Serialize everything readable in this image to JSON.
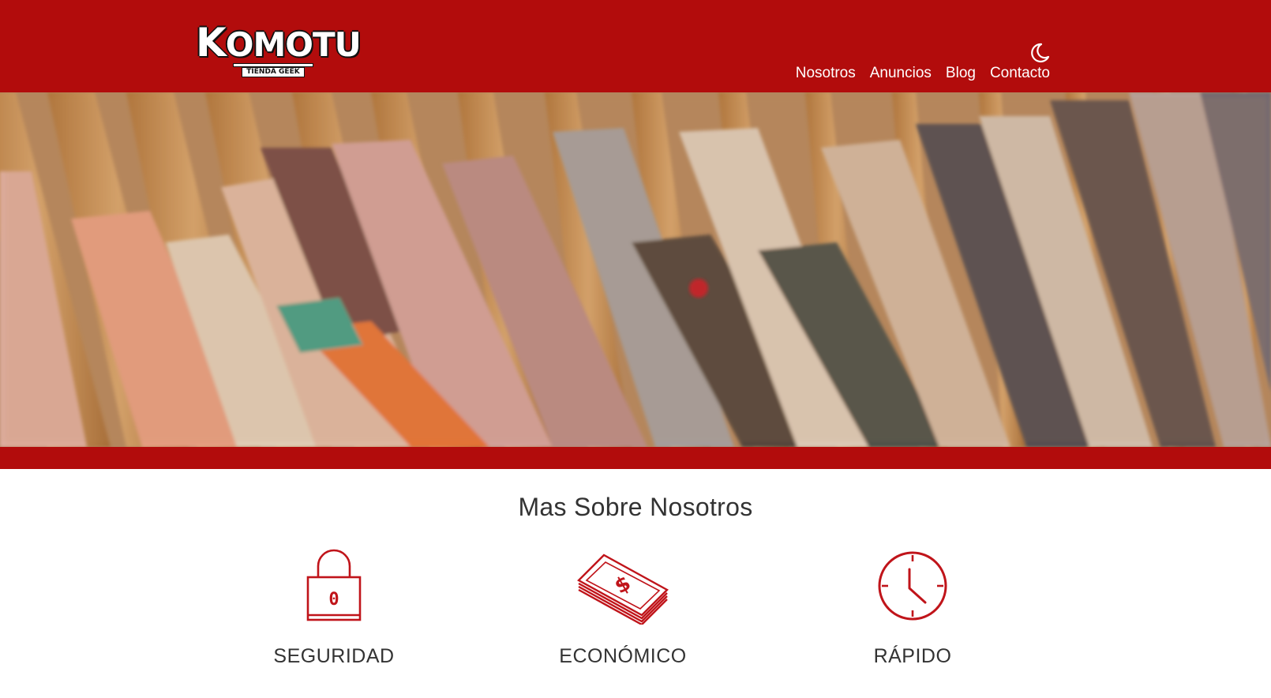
{
  "brand": {
    "name": "KOMOTU",
    "tagline": "TIENDA GEEK",
    "color": "#b20c0c"
  },
  "header": {
    "theme_icon": "moon-icon"
  },
  "nav": {
    "items": [
      "Nosotros",
      "Anuncios",
      "Blog",
      "Contacto"
    ]
  },
  "hero": {
    "image": "clothes-on-hangers-photo"
  },
  "about": {
    "title": "Mas Sobre Nosotros",
    "features": [
      {
        "label": "SEGURIDAD",
        "icon": "padlock-icon"
      },
      {
        "label": "ECONÓMICO",
        "icon": "money-stack-icon"
      },
      {
        "label": "RÁPIDO",
        "icon": "clock-icon"
      }
    ]
  }
}
